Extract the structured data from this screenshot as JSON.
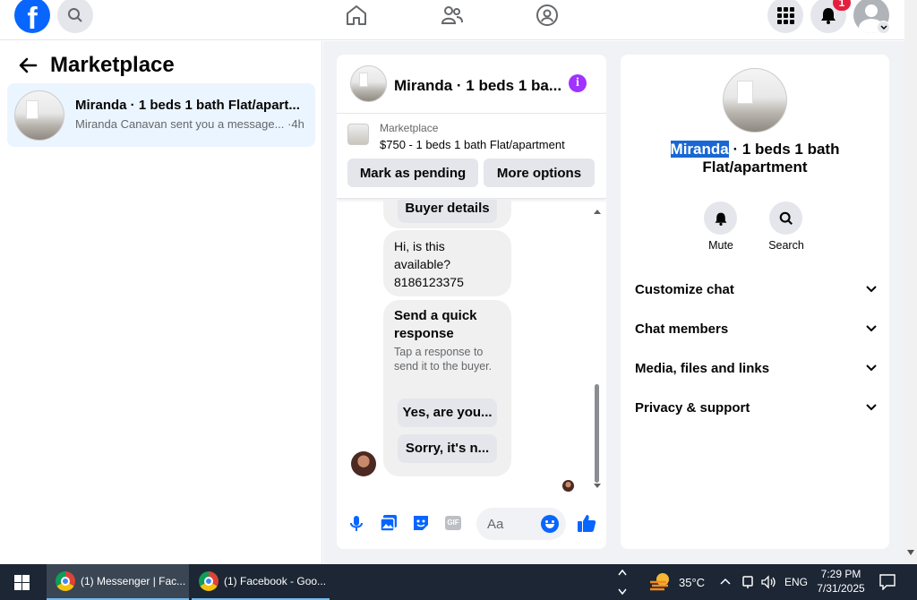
{
  "topbar": {
    "logo_letter": "f",
    "notif_count": "1",
    "icons": [
      "facebook-logo",
      "search-icon",
      "home-icon",
      "friends-icon",
      "groups-icon",
      "menu-grid-icon",
      "bell-icon",
      "profile-avatar"
    ]
  },
  "left": {
    "title": "Marketplace",
    "conversation": {
      "name": "Miranda · 1 beds 1 bath Flat/apart...",
      "preview": "Miranda Canavan sent you a message... ·4h"
    }
  },
  "chat": {
    "header_title": "Miranda · 1 beds 1 ba...",
    "listing_source": "Marketplace",
    "listing_summary": "$750 - 1 beds 1 bath Flat/apartment",
    "mark_pending": "Mark as pending",
    "more_options": "More options",
    "buyer_details": "Buyer details",
    "message": "Hi, is this available? 8186123375",
    "quick_title": "Send a quick response",
    "quick_sub": "Tap a response to send it to the buyer.",
    "quick_reply_1": "Yes, are you...",
    "quick_reply_2": "Sorry, it's n...",
    "composer_placeholder": "Aa"
  },
  "info": {
    "name_highlight": "Miranda",
    "name_rest": " · 1 beds 1 bath Flat/apartment",
    "mute_label": "Mute",
    "search_label": "Search",
    "sections": [
      "Customize chat",
      "Chat members",
      "Media, files and links",
      "Privacy & support"
    ]
  },
  "taskbar": {
    "task1": "(1) Messenger | Fac...",
    "task2": "(1) Facebook - Goo...",
    "temperature": "35°C",
    "lang": "ENG",
    "time": "7:29 PM",
    "date": "7/31/2025"
  },
  "colors": {
    "accent": "#0866ff",
    "purple": "#a033ff",
    "taskbar": "#1c2634"
  }
}
